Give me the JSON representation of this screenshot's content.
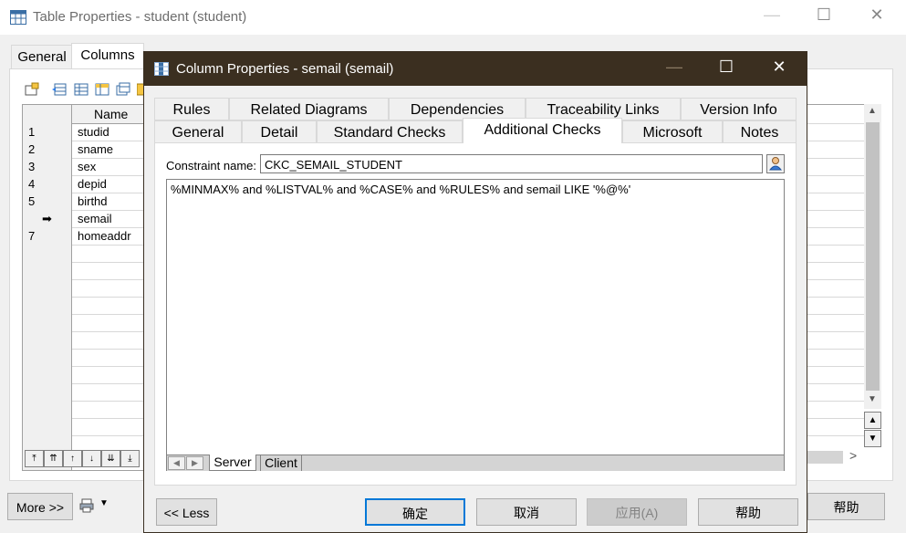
{
  "outer_window": {
    "title": "Table Properties - student (student)",
    "controls": {
      "minimize": "—",
      "maximize": "☐",
      "close": "✕"
    },
    "tabs": [
      "General",
      "Columns"
    ],
    "grid": {
      "header": "Name",
      "rows": [
        {
          "num": "1",
          "name": "studid"
        },
        {
          "num": "2",
          "name": "sname"
        },
        {
          "num": "3",
          "name": "sex"
        },
        {
          "num": "4",
          "name": "depid"
        },
        {
          "num": "5",
          "name": "birthd"
        },
        {
          "num": "➡",
          "name": "semail"
        },
        {
          "num": "7",
          "name": "homeaddr"
        }
      ]
    },
    "nav_buttons": [
      "⤒",
      "⇈",
      "↑",
      "↓",
      "⇊",
      "⤓"
    ],
    "more_button": "More >>",
    "help_button": "帮助",
    "scroll": {
      "up": "▲",
      "down": "▼",
      "right": ">"
    }
  },
  "dialog": {
    "title": "Column Properties - semail (semail)",
    "controls": {
      "minimize": "—",
      "maximize": "☐",
      "close": "✕"
    },
    "tabs_row1": [
      "Rules",
      "Related Diagrams",
      "Dependencies",
      "Traceability Links",
      "Version Info"
    ],
    "tabs_row2": [
      "General",
      "Detail",
      "Standard Checks",
      "Additional Checks",
      "Microsoft",
      "Notes"
    ],
    "active_tab": "Additional Checks",
    "constraint_label": "Constraint name:",
    "constraint_value": "CKC_SEMAIL_STUDENT",
    "expression": "%MINMAX% and %LISTVAL% and %CASE% and %RULES% and semail LIKE '%@%'",
    "sub_tabs": [
      "Server",
      "Client"
    ],
    "buttons": {
      "less": "<< Less",
      "ok": "确定",
      "cancel": "取消",
      "apply": "应用(A)",
      "help": "帮助"
    }
  }
}
